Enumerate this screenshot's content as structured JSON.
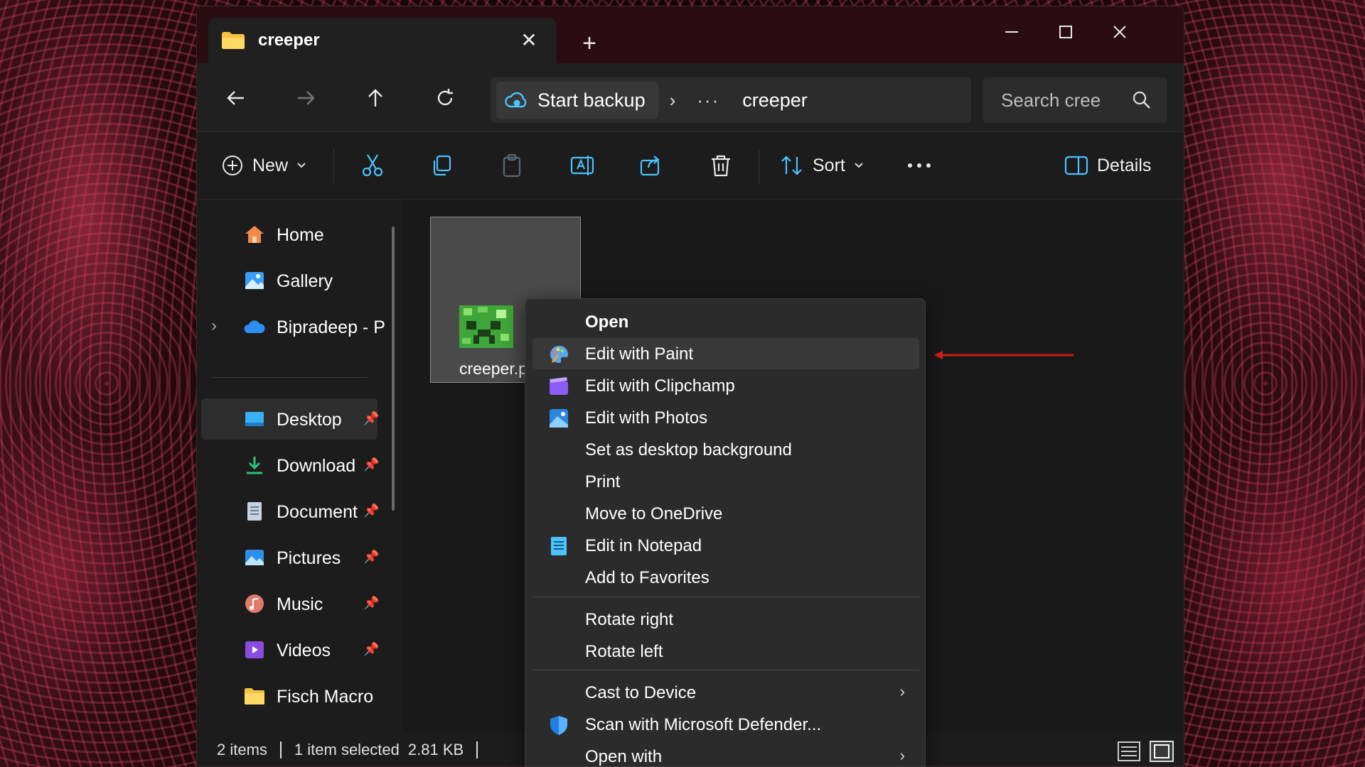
{
  "window": {
    "tab_title": "creeper",
    "controls": {
      "minimize": "—",
      "maximize": "☐",
      "close": "✕"
    }
  },
  "address": {
    "backup_label": "Start backup",
    "breadcrumb": "creeper",
    "search_placeholder": "Search cree"
  },
  "toolbar": {
    "new_label": "New",
    "sort_label": "Sort",
    "details_label": "Details"
  },
  "sidebar": {
    "items": [
      {
        "label": "Home",
        "icon": "home-icon"
      },
      {
        "label": "Gallery",
        "icon": "gallery-icon"
      },
      {
        "label": "Bipradeep - P",
        "icon": "onedrive-icon"
      },
      {
        "label": "Desktop",
        "icon": "desktop-icon",
        "pinned": true,
        "selected": true
      },
      {
        "label": "Download",
        "icon": "download-icon",
        "pinned": true
      },
      {
        "label": "Document",
        "icon": "document-icon",
        "pinned": true
      },
      {
        "label": "Pictures",
        "icon": "pictures-icon",
        "pinned": true
      },
      {
        "label": "Music",
        "icon": "music-icon",
        "pinned": true
      },
      {
        "label": "Videos",
        "icon": "videos-icon",
        "pinned": true
      },
      {
        "label": "Fisch Macro",
        "icon": "folder-icon"
      }
    ]
  },
  "file": {
    "name": "creeper.p"
  },
  "status": {
    "items": "2 items",
    "selected": "1 item selected",
    "size": "2.81 KB"
  },
  "context_menu": {
    "items": [
      {
        "label": "Open",
        "bold": true
      },
      {
        "label": "Edit with Paint",
        "icon": "paint-icon",
        "highlighted": true
      },
      {
        "label": "Edit with Clipchamp",
        "icon": "clipchamp-icon"
      },
      {
        "label": "Edit with Photos",
        "icon": "photos-icon"
      },
      {
        "label": "Set as desktop background"
      },
      {
        "label": "Print"
      },
      {
        "label": "Move to OneDrive"
      },
      {
        "label": "Edit in Notepad",
        "icon": "notepad-icon"
      },
      {
        "label": "Add to Favorites"
      },
      {
        "label": "Rotate right"
      },
      {
        "label": "Rotate left"
      },
      {
        "label": "Cast to Device",
        "submenu": true
      },
      {
        "label": "Scan with Microsoft Defender...",
        "icon": "defender-icon"
      },
      {
        "label": "Open with",
        "submenu": true
      }
    ]
  },
  "colors": {
    "annotation_arrow": "#d11a1a",
    "folder": "#f5c242",
    "accent": "#4cc2ff"
  }
}
